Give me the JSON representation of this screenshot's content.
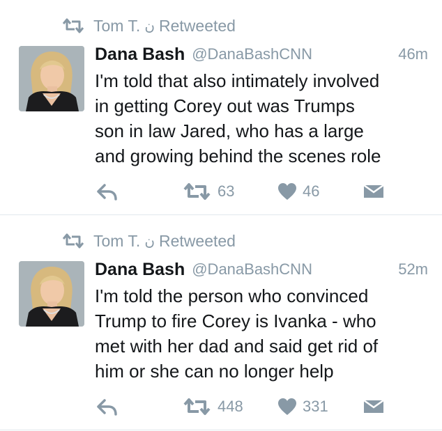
{
  "tweets": [
    {
      "retweeted_by": "Tom T.",
      "retweeted_by_extra": "ن",
      "retweeted_label": "Retweeted",
      "author_name": "Dana Bash",
      "author_handle": "@DanaBashCNN",
      "time": "46m",
      "text_lines": [
        "I'm told that also intimately involved",
        "in getting Corey out was Trumps",
        "son in law Jared, who has a large",
        "and growing behind the scenes role"
      ],
      "retweets": "63",
      "likes": "46"
    },
    {
      "retweeted_by": "Tom T.",
      "retweeted_by_extra": "ن",
      "retweeted_label": "Retweeted",
      "author_name": "Dana Bash",
      "author_handle": "@DanaBashCNN",
      "time": "52m",
      "text_lines": [
        "I'm told the person who convinced",
        "Trump to fire Corey is Ivanka - who",
        "met with her dad and said get rid of",
        "him or she can no longer help"
      ],
      "retweets": "448",
      "likes": "331"
    }
  ],
  "colors": {
    "text": "#14171a",
    "muted": "#8899a6",
    "divider": "#e1e8ed"
  },
  "icons": {
    "retweet": "retweet-icon",
    "reply": "reply-icon",
    "like": "heart-icon",
    "dm": "envelope-icon"
  }
}
